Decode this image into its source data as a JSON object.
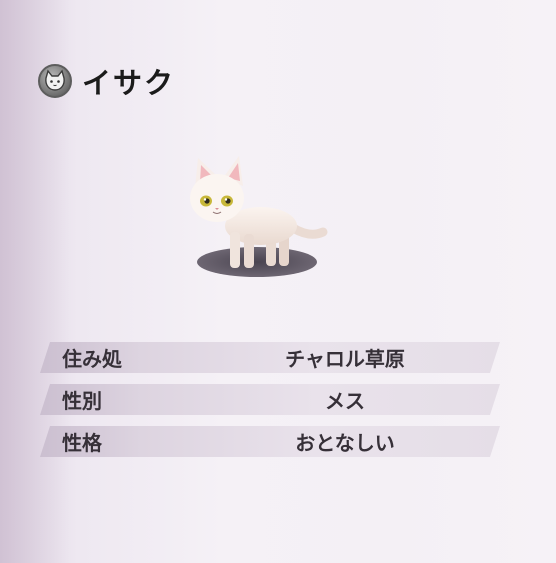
{
  "profile": {
    "name": "イサク",
    "badge_icon": "cat-face-icon",
    "portrait_icon": "white-cat-icon"
  },
  "details": [
    {
      "label": "住み処",
      "value": "チャロル草原"
    },
    {
      "label": "性別",
      "value": "メス"
    },
    {
      "label": "性格",
      "value": "おとなしい"
    }
  ],
  "colors": {
    "row_bg": "#e2d9e5",
    "text": "#363038",
    "title": "#1b1b1b"
  }
}
